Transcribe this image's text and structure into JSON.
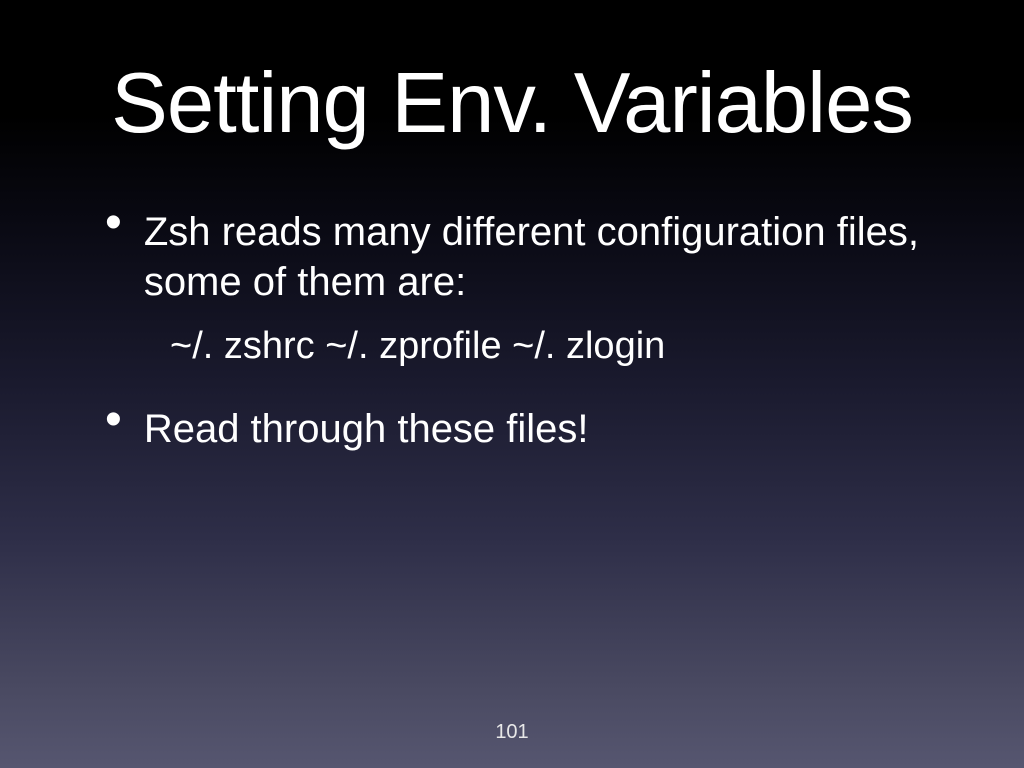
{
  "slide": {
    "title": "Setting Env. Variables",
    "bullets": [
      {
        "text": "Zsh reads many different configuration files, some of them are:"
      },
      {
        "text": "Read through these files!"
      }
    ],
    "file_list": "~/. zshrc  ~/. zprofile  ~/. zlogin",
    "page_number": "101"
  }
}
